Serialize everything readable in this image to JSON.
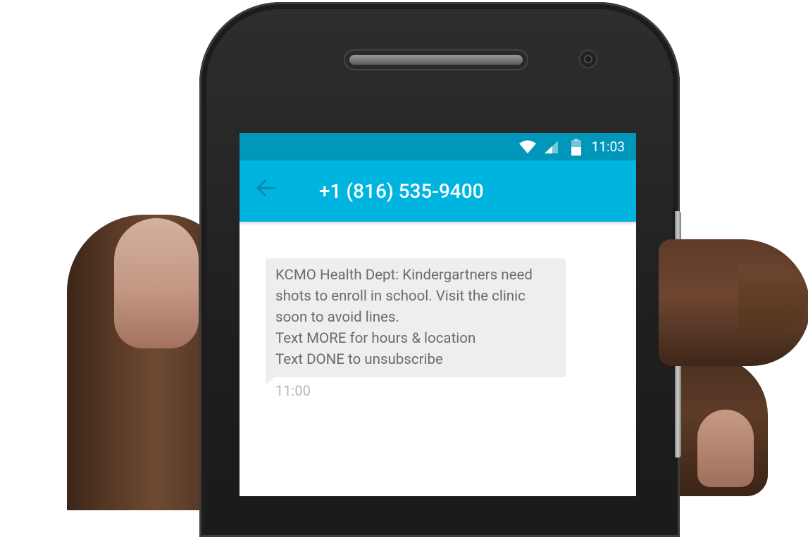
{
  "status_bar": {
    "time": "11:03",
    "icons": [
      "wifi-icon",
      "signal-icon",
      "battery-icon"
    ]
  },
  "app_bar": {
    "back_icon": "arrow-left-icon",
    "title": "+1 (816) 535-9400"
  },
  "conversation": {
    "messages": [
      {
        "lines": [
          "KCMO Health Dept: Kindergartners need",
          "shots to enroll in school. Visit the clinic",
          "soon to avoid lines.",
          "Text MORE for hours & location",
          "Text DONE to unsubscribe"
        ],
        "time": "11:00"
      }
    ]
  },
  "colors": {
    "status_bar": "#0097bb",
    "app_bar": "#00b4e0",
    "bubble": "#eeeeee",
    "message_text": "#6b6b6b",
    "timestamp": "#b5b5b5"
  }
}
